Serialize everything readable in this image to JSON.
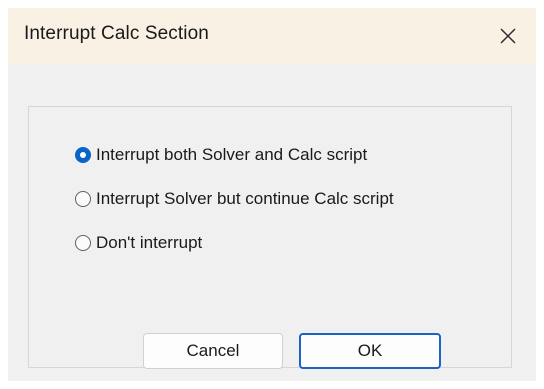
{
  "dialog": {
    "title": "Interrupt Calc Section",
    "close_icon": "close-icon"
  },
  "options": [
    {
      "label": "Interrupt both Solver and Calc script",
      "checked": true
    },
    {
      "label": "Interrupt Solver but continue Calc script",
      "checked": false
    },
    {
      "label": "Don't interrupt",
      "checked": false
    }
  ],
  "buttons": {
    "cancel_label": "Cancel",
    "ok_label": "OK"
  },
  "colors": {
    "titlebar_bg": "#f8f1e4",
    "dialog_bg": "#f0f0f0",
    "accent": "#0a63c9"
  }
}
